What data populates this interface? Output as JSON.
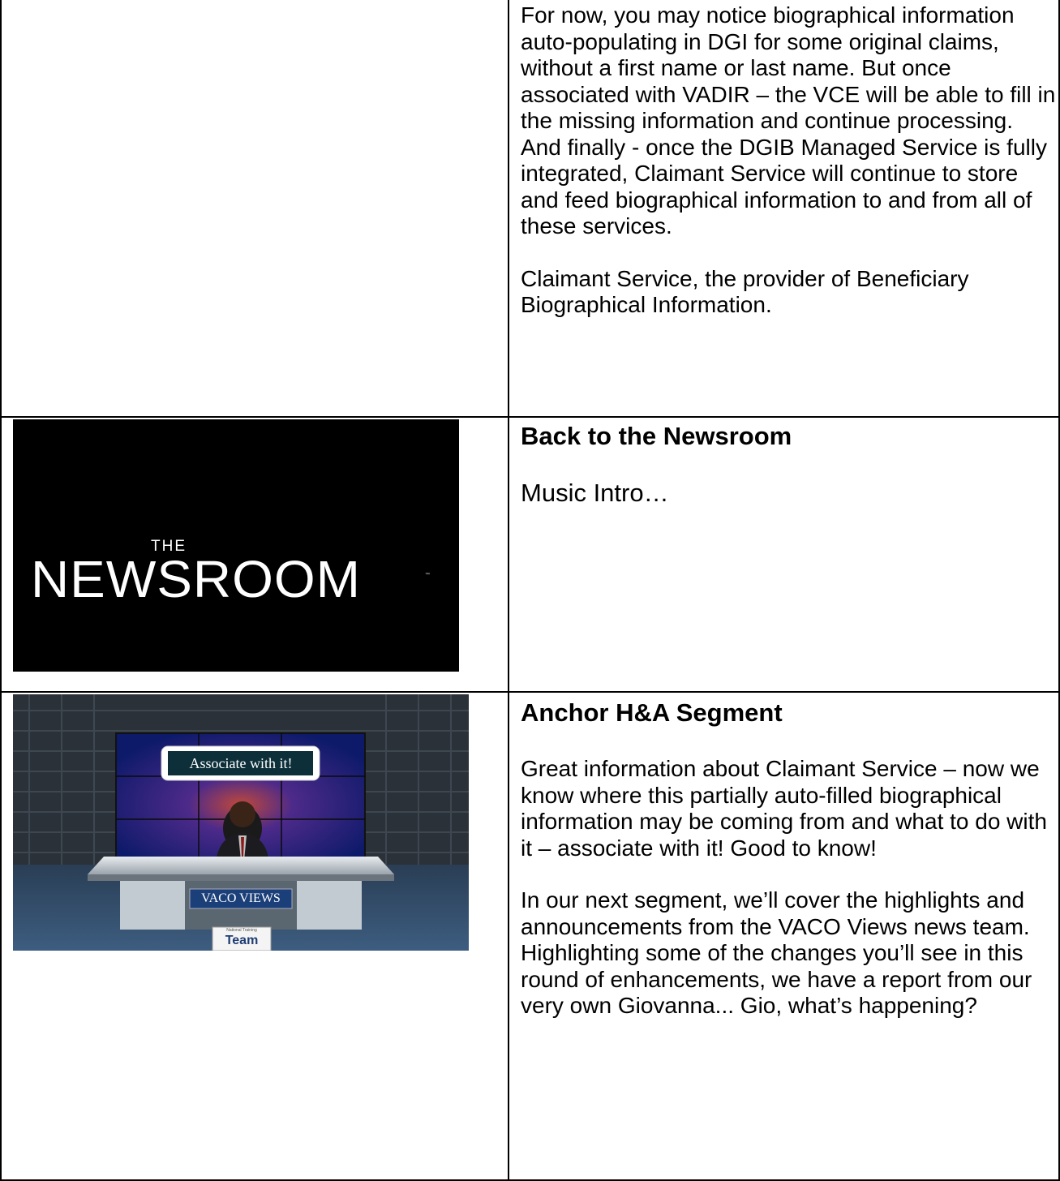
{
  "row1": {
    "paragraph1": "For now, you may notice biographical information auto-populating in DGI for some original claims, without a first name or last name.  But once associated with VADIR – the VCE will be able to fill in the missing information and continue processing.  And finally - once the DGIB Managed Service is fully integrated, Claimant Service will continue to store and feed biographical information to and from all of these services.",
    "paragraph2": "Claimant Service, the provider of Beneficiary Biographical Information."
  },
  "row2": {
    "image": {
      "the": "THE",
      "name": "NEWSROOM",
      "tm": "™"
    },
    "heading": "Back to the Newsroom",
    "body": "Music Intro…"
  },
  "row3": {
    "image": {
      "screen_caption": "Associate with it!",
      "desk_sign": "VACO VIEWS",
      "logo_text": "Team",
      "logo_subtext": "National Training"
    },
    "heading": "Anchor H&A Segment",
    "paragraph1": "Great information about Claimant Service – now we know where this partially auto-filled biographical information may be coming from and what to do with it – associate with it!  Good to know!",
    "paragraph2": "In our next segment, we’ll cover the highlights and announcements from the VACO Views news team.  Highlighting some of the changes you’ll see in this round of enhancements, we have a report from our very own Giovanna...  Gio, what’s happening?"
  }
}
